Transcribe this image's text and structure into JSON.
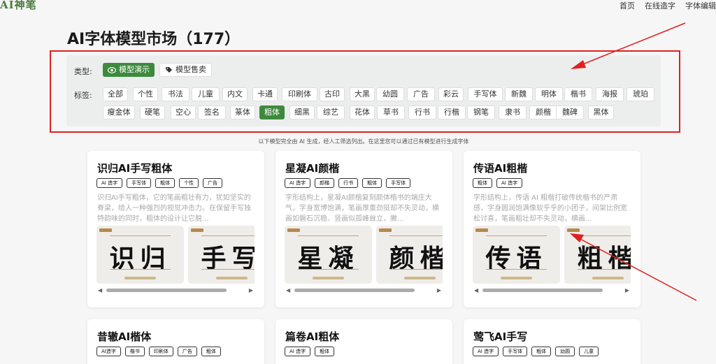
{
  "logo_text": "AI神笔",
  "nav": {
    "home": "首页",
    "online_create": "在线造字",
    "font_edit": "字体编辑"
  },
  "page_title": "AI字体模型市场（177）",
  "filter": {
    "type_label": "类型:",
    "type_demo": "模型演示",
    "type_sale": "模型售卖",
    "tag_label": "标签:",
    "tags_row1": [
      "全部",
      "个性",
      "书法",
      "儿童",
      "内文",
      "卡通",
      "印刷体",
      "古印",
      "大黑",
      "幼圆",
      "广告",
      "彩云",
      "手写体",
      "新魏",
      "明体",
      "楷书",
      "海报",
      "琥珀"
    ],
    "tags_row2": [
      "瘦金体",
      "硬笔",
      "空心",
      "签名",
      "篆体",
      "粗体",
      "细黑",
      "综艺",
      "花体",
      "草书",
      "行书",
      "行楷",
      "钢笔",
      "隶书",
      "颜楷",
      "魏碑",
      "黑体"
    ],
    "active_tag": "粗体"
  },
  "notice": "以下模型完全由 AI 生成，经人工筛选列出。在这里您可以通过已有模型进行生成字体",
  "cards": [
    {
      "title": "识归AI手写粗体",
      "tags": [
        "AI 造字",
        "手写体",
        "粗体",
        "个性",
        "广告"
      ],
      "desc": "识归AI手写粗体，它的笔画粗壮有力，犹如坚实的脊梁，给人一种强烈的视觉冲击力。在保留手写独特韵味的同时，粗体的设计让它脱...",
      "preview1": "识归",
      "preview2": "手写"
    },
    {
      "title": "星凝AI颜楷",
      "tags": [
        "AI 造字",
        "颜楷",
        "行书",
        "粗体",
        "手写体"
      ],
      "desc": "字形结构上，星凝AI颜楷复刻颜体楷书的端庄大气，字身宽博饱满，笔画厚重劲挺却不失灵动，横画如磐石沉稳、竖画似孤峰耸立，撇...",
      "preview1": "星凝",
      "preview2": "颜楷"
    },
    {
      "title": "传语AI粗楷",
      "tags": [
        "粗体",
        "AI 造字"
      ],
      "desc": "字形结构上，传语 AI 粗楷打破传统楷书的严肃感，字身圆润饱满像软乎乎的小团子，间架比例宽松讨喜，笔画粗壮却不失灵动，横画...",
      "preview1": "传语",
      "preview2": "粗楷"
    },
    {
      "title": "昔辙AI楷体",
      "tags": [
        "AI造字",
        "楷书",
        "印刷体",
        "广告",
        "粗体"
      ]
    },
    {
      "title": "篇卷AI粗体",
      "tags": [
        "AI 造字",
        "粗体"
      ]
    },
    {
      "title": "莺飞AI手写",
      "tags": [
        "AI 造字",
        "手写体",
        "粗体",
        "幼圆",
        "儿童"
      ]
    }
  ],
  "colors": {
    "accent": "#3d8a3d",
    "annotation": "#e02020"
  },
  "icons": {
    "type_demo": "eye-icon",
    "type_sale": "tag-icon"
  }
}
